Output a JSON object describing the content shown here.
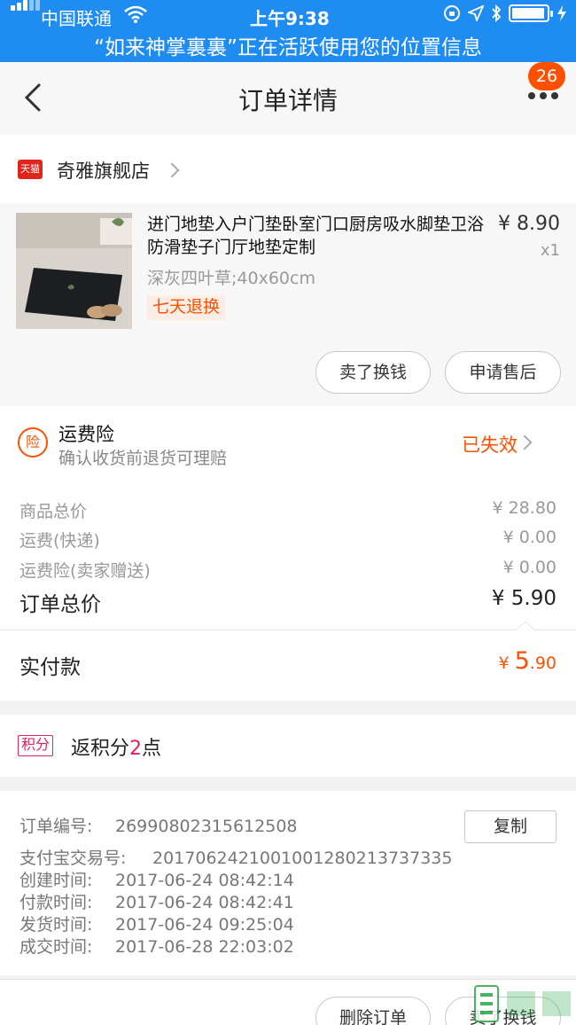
{
  "status_bar": {
    "carrier": "中国联通",
    "time": "上午9:38",
    "location_notice": "“如来神掌裏裏”正在活跃使用您的位置信息"
  },
  "nav": {
    "title": "订单详情",
    "badge": "26",
    "icons": {
      "back": "back-chevron-icon",
      "more": "more-dots-icon"
    }
  },
  "store": {
    "name": "奇雅旗舰店",
    "platform_tag": "天猫"
  },
  "item": {
    "title": "进门地垫入户门垫卧室门口厨房吸水脚垫卫浴防滑垫子门厅地垫定制",
    "price": "¥ 8.90",
    "quantity": "x1",
    "sku": "深灰四叶草;40x60cm",
    "tag": "七天退换",
    "actions": [
      "卖了换钱",
      "申请售后"
    ]
  },
  "insurance": {
    "icon_text": "险",
    "title": "运费险",
    "subtitle": "确认收货前退货可理赔",
    "status": "已失效"
  },
  "price_rows": [
    {
      "label": "商品总价",
      "value": "¥ 28.80"
    },
    {
      "label": "运费(快递)",
      "value": "¥ 0.00"
    },
    {
      "label": "运费险(卖家赠送)",
      "value": "¥ 0.00"
    }
  ],
  "total": {
    "label": "订单总价",
    "value": "¥ 5.90"
  },
  "paid": {
    "label": "实付款",
    "currency": "¥ ",
    "int": "5",
    "dec": ".90"
  },
  "points": {
    "tag": "积分",
    "prefix": "返积分",
    "count": "2",
    "suffix": "点"
  },
  "order_info": {
    "copy_label": "复制",
    "rows": [
      {
        "label": "订单编号:",
        "value": "26990802315612508"
      },
      {
        "label": "支付宝交易号:",
        "value": "2017062421001001280213737335"
      },
      {
        "label": "创建时间:",
        "value": "2017-06-24 08:42:14"
      },
      {
        "label": "付款时间:",
        "value": "2017-06-24 08:42:41"
      },
      {
        "label": "发货时间:",
        "value": "2017-06-24 09:25:04"
      },
      {
        "label": "成交时间:",
        "value": "2017-06-28 22:03:02"
      }
    ]
  },
  "bottom_actions": [
    "删除订单",
    "卖了换钱"
  ],
  "colors": {
    "accent": "#ff5000",
    "status_bar": "#1e8cf0",
    "points": "#e0245e"
  }
}
